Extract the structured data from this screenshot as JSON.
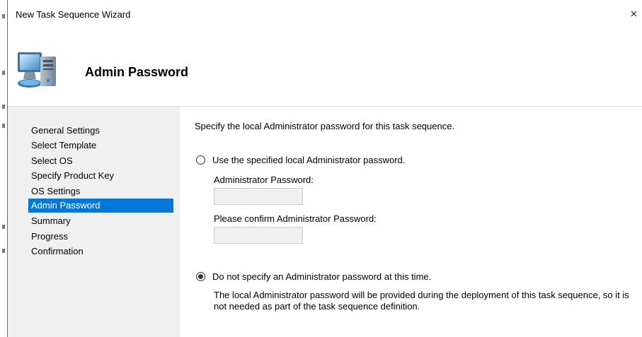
{
  "window": {
    "title": "New Task Sequence Wizard"
  },
  "header": {
    "title": "Admin Password",
    "icon": "computer-icon"
  },
  "nav": {
    "items": [
      {
        "label": "General Settings"
      },
      {
        "label": "Select Template"
      },
      {
        "label": "Select OS"
      },
      {
        "label": "Specify Product Key"
      },
      {
        "label": "OS Settings"
      },
      {
        "label": "Admin Password",
        "selected": true
      },
      {
        "label": "Summary"
      },
      {
        "label": "Progress"
      },
      {
        "label": "Confirmation"
      }
    ]
  },
  "content": {
    "intro": "Specify the local Administrator password for this task sequence.",
    "option_specified": {
      "label": "Use the specified local Administrator password.",
      "selected": false
    },
    "password_label": "Administrator Password:",
    "password_value": "",
    "confirm_label": "Please confirm Administrator Password:",
    "confirm_value": "",
    "option_none": {
      "label": "Do not specify an Administrator password at this time.",
      "selected": true
    },
    "description": "The local Administrator password will be provided during the deployment of this task sequence, so it is not needed as part of the task sequence definition."
  },
  "colors": {
    "selection": "#0078d7",
    "nav_background": "#f0f0f0"
  }
}
